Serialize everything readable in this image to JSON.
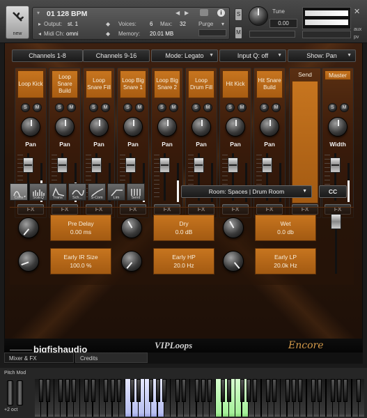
{
  "header": {
    "instrument_name": "01 128 BPM",
    "output_label": "Output:",
    "output_value": "st. 1",
    "voices_label": "Voices:",
    "voices_value": "6",
    "max_label": "Max:",
    "max_value": "32",
    "purge_label": "Purge",
    "midi_label": "Midi Ch:",
    "midi_value": "omni",
    "memory_label": "Memory:",
    "memory_value": "20.01 MB",
    "new_label": "new",
    "s_label": "S",
    "m_label": "M",
    "tune_label": "Tune",
    "tune_value": "0.00",
    "aux_label": "aux",
    "pv_label": "pv",
    "close_glyph": "✕"
  },
  "top_buttons": [
    {
      "label": "Channels 1-8"
    },
    {
      "label": "Channels 9-16"
    },
    {
      "label": "Mode: Legato"
    },
    {
      "label": "Input Q: off"
    },
    {
      "label": "Show: Pan"
    }
  ],
  "strips": [
    {
      "label": "Loop Kick",
      "knob_label": "Pan",
      "meter": 0.55,
      "fx": "FX"
    },
    {
      "label": "Loop Snare Build",
      "knob_label": "Pan",
      "meter": 0.5,
      "fx": "FX"
    },
    {
      "label": "Loop Snare Fill",
      "knob_label": "Pan",
      "meter": 0.0,
      "fx": "FX"
    },
    {
      "label": "Loop Big Snare 1",
      "knob_label": "Pan",
      "meter": 0.3,
      "fx": "FX"
    },
    {
      "label": "Loop Big Snare 2",
      "knob_label": "Pan",
      "meter": 0.55,
      "fx": "FX"
    },
    {
      "label": "Loop Drum Fill",
      "knob_label": "Pan",
      "meter": 0.0,
      "fx": "FX"
    },
    {
      "label": "Hit Kick",
      "knob_label": "Pan",
      "meter": 0.0,
      "fx": "FX"
    },
    {
      "label": "Hit Snare Build",
      "knob_label": "Pan",
      "meter": 0.0,
      "fx": "FX"
    }
  ],
  "send": {
    "label": "Send",
    "fx": "FX"
  },
  "master": {
    "label": "Master",
    "knob_label": "Width",
    "meter": 0.55,
    "fx": "FX"
  },
  "fx_tabs": [
    "Conv",
    "SGEQ",
    "Trans",
    "Sch...",
    "S-Com",
    "Lim",
    "Send"
  ],
  "room_select": "Room: Spaces | Drum Room",
  "cc_label": "CC",
  "reverb": {
    "pre_delay": {
      "name": "Pre Delay",
      "value": "0.00 ms"
    },
    "dry": {
      "name": "Dry",
      "value": "0.0 dB"
    },
    "wet": {
      "name": "Wet",
      "value": "0.0 db"
    },
    "early_ir": {
      "name": "Early IR Size",
      "value": "100.0 %"
    },
    "early_hp": {
      "name": "Early HP",
      "value": "20.0 Hz"
    },
    "early_lp": {
      "name": "Early LP",
      "value": "20.0k Hz"
    }
  },
  "footer": {
    "brand": "bigfishaudio",
    "viploops": "VIPLoops",
    "encore": "Encore",
    "tab_mixer": "Mixer & FX",
    "tab_credits": "Credits"
  },
  "keyboard": {
    "pitch_label": "Pitch Mod",
    "oct_label": "+2 oct"
  }
}
